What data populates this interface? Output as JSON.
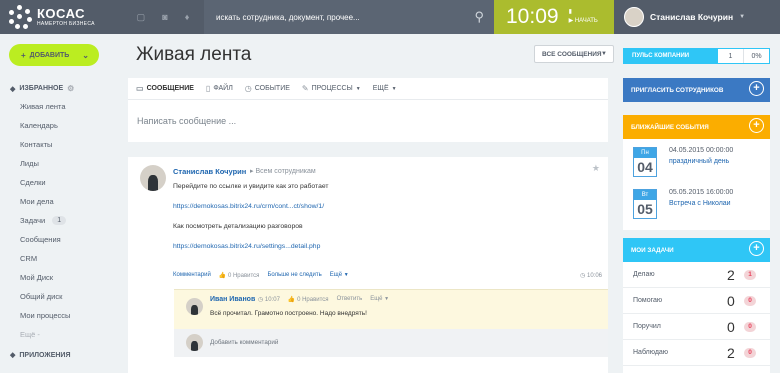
{
  "header": {
    "logo_title": "КОСАС",
    "logo_subtitle": "НАМЕРТОН БИЗНЕСА",
    "search_placeholder": "искать сотрудника, документ, прочее...",
    "time": "10:09",
    "start_label": "НАЧАТЬ",
    "user_name": "Станислав Кочурин"
  },
  "sidebar": {
    "add_label": "ДОБАВИТЬ",
    "favorites_label": "ИЗБРАННОЕ",
    "items": [
      {
        "label": "Живая лента"
      },
      {
        "label": "Календарь"
      },
      {
        "label": "Контакты"
      },
      {
        "label": "Лиды"
      },
      {
        "label": "Сделки"
      },
      {
        "label": "Мои дела"
      },
      {
        "label": "Задачи",
        "badge": "1"
      },
      {
        "label": "Сообщения"
      },
      {
        "label": "CRM"
      },
      {
        "label": "Мой Диск"
      },
      {
        "label": "Общий диск"
      },
      {
        "label": "Мои процессы"
      }
    ],
    "more_label": "Ещё -",
    "apps_label": "ПРИЛОЖЕНИЯ"
  },
  "main": {
    "title": "Живая лента",
    "filter_label": "ВСЕ СООБЩЕНИЯ",
    "composer": {
      "tabs": [
        "СООБЩЕНИЕ",
        "ФАЙЛ",
        "СОБЫТИЕ",
        "ПРОЦЕССЫ",
        "ЕЩЁ"
      ],
      "placeholder": "Написать сообщение ..."
    },
    "post": {
      "author": "Станислав Кочурин",
      "destination": "Всем сотрудникам",
      "line1": "Перейдите по ссылке и увидите как это работает",
      "link1": "https://demokosas.bitrix24.ru/crm/cont...ct/show/1/",
      "line2": "Как посмотреть детализацию разговоров",
      "link2": "https://demokosas.bitrix24.ru/settings...detail.php",
      "actions": {
        "comments": "Комментарий",
        "like": "0 Нравится",
        "unfollow": "Больше не следить",
        "more": "Ещё"
      },
      "time": "10:06",
      "comment": {
        "author": "Иван Иванов",
        "time": "10:07",
        "like": "0 Нравится",
        "reply": "Ответить",
        "more": "Ещё",
        "text": "Всё прочитал. Грамотно построено. Надо внедрять!"
      },
      "add_comment_placeholder": "Добавить комментарий"
    }
  },
  "right": {
    "pulse": {
      "label": "ПУЛЬС КОМПАНИИ",
      "value1": "1",
      "value2": "0%"
    },
    "invite_label": "ПРИГЛАСИТЬ СОТРУДНИКОВ",
    "events_label": "БЛИЖАЙШИЕ СОБЫТИЯ",
    "events": [
      {
        "day": "Пн",
        "num": "04",
        "datetime": "04.05.2015 00:00:00",
        "name": "праздничный день"
      },
      {
        "day": "Вт",
        "num": "05",
        "datetime": "05.05.2015 16:00:00",
        "name": "Встреча с Николаи"
      }
    ],
    "tasks_label": "МОИ ЗАДАЧИ",
    "tasks": [
      {
        "label": "Делаю",
        "count": "2",
        "badge": "1"
      },
      {
        "label": "Помогаю",
        "count": "0",
        "badge": "0"
      },
      {
        "label": "Поручил",
        "count": "0",
        "badge": "0"
      },
      {
        "label": "Наблюдаю",
        "count": "2",
        "badge": "0"
      }
    ]
  },
  "colors": {
    "topbar": "#535c69",
    "clock": "#abbc2e",
    "add_button": "#bbed21",
    "link": "#2067b0",
    "invite": "#3b79c3",
    "events": "#fbad00",
    "tasks": "#2fc6f6"
  }
}
